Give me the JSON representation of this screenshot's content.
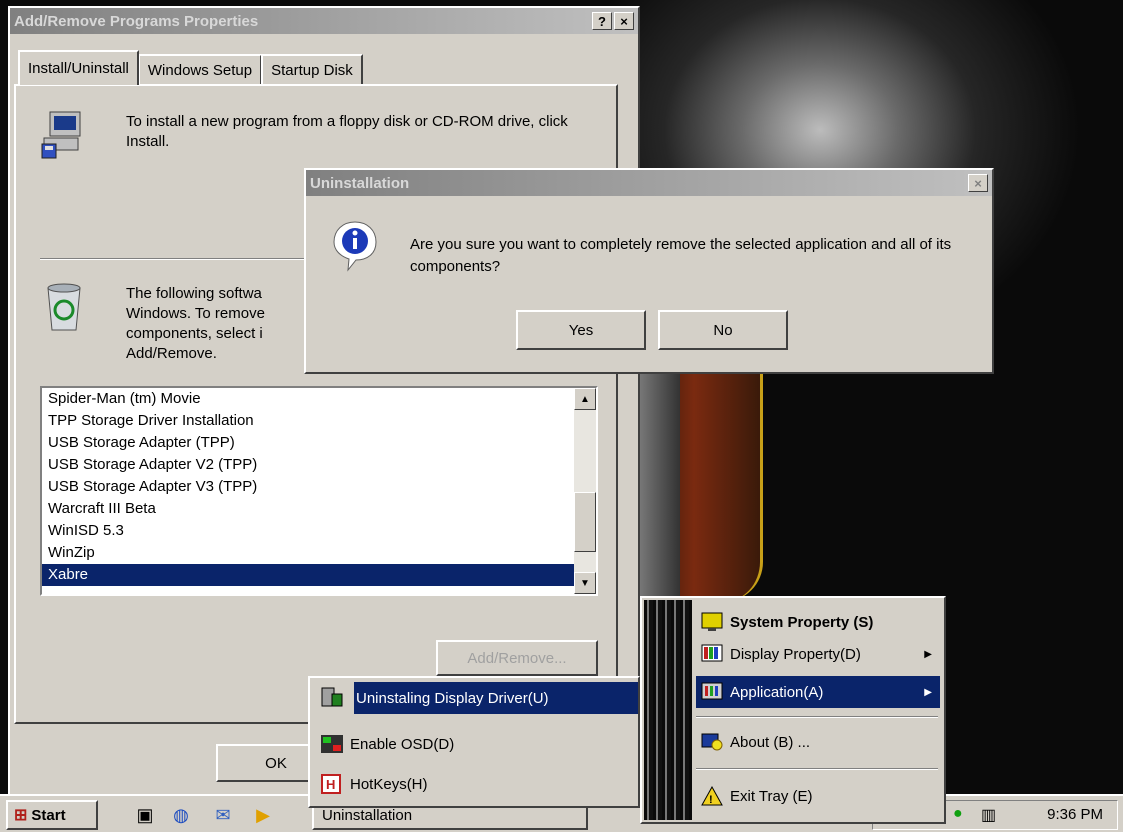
{
  "colors": {
    "selection": "#0a246a",
    "dialog_face": "#d4d0c8"
  },
  "main_dialog": {
    "title": "Add/Remove Programs Properties",
    "help_btn": "?",
    "close_btn": "×",
    "tabs": [
      "Install/Uninstall",
      "Windows Setup",
      "Startup Disk"
    ],
    "install_text": "To install a new program from a floppy disk or CD-ROM drive, click Install.",
    "remove_text": "The following softwa Windows. To remove components, select i Add/Remove.",
    "programs": [
      "Spider-Man (tm) Movie",
      "TPP Storage Driver Installation",
      "USB Storage Adapter (TPP)",
      "USB Storage Adapter V2 (TPP)",
      "USB Storage Adapter V3 (TPP)",
      "Warcraft III Beta",
      "WinISD 5.3",
      "WinZip",
      "Xabre"
    ],
    "selected_program": "Xabre",
    "add_remove_btn": "Add/Remove...",
    "ok_btn": "OK"
  },
  "uninstall_dialog": {
    "title": "Uninstallation",
    "close_btn": "×",
    "message": "Are you sure you want to completely remove the selected application and all of its components?",
    "yes_btn": "Yes",
    "no_btn": "No"
  },
  "tray_menu": {
    "items": [
      {
        "label": "System Property (S)",
        "icon": "monitor-icon"
      },
      {
        "label": "Display Property(D)",
        "icon": "color-bars-icon"
      },
      {
        "label": "Application(A)",
        "icon": "application-icon"
      },
      {
        "label": "About (B) ...",
        "icon": "about-icon"
      },
      {
        "label": "Exit Tray (E)",
        "icon": "exit-icon"
      }
    ]
  },
  "app_submenu": {
    "items": [
      {
        "label": "Uninstaling Display Driver(U)",
        "icon": "uninstall-icon"
      },
      {
        "label": "Enable OSD(D)",
        "icon": "osd-icon"
      },
      {
        "label": "HotKeys(H)",
        "icon": "hotkeys-icon"
      }
    ]
  },
  "taskbar": {
    "start_label": "Start",
    "task_label": "Uninstallation",
    "clock": "9:36 PM"
  }
}
